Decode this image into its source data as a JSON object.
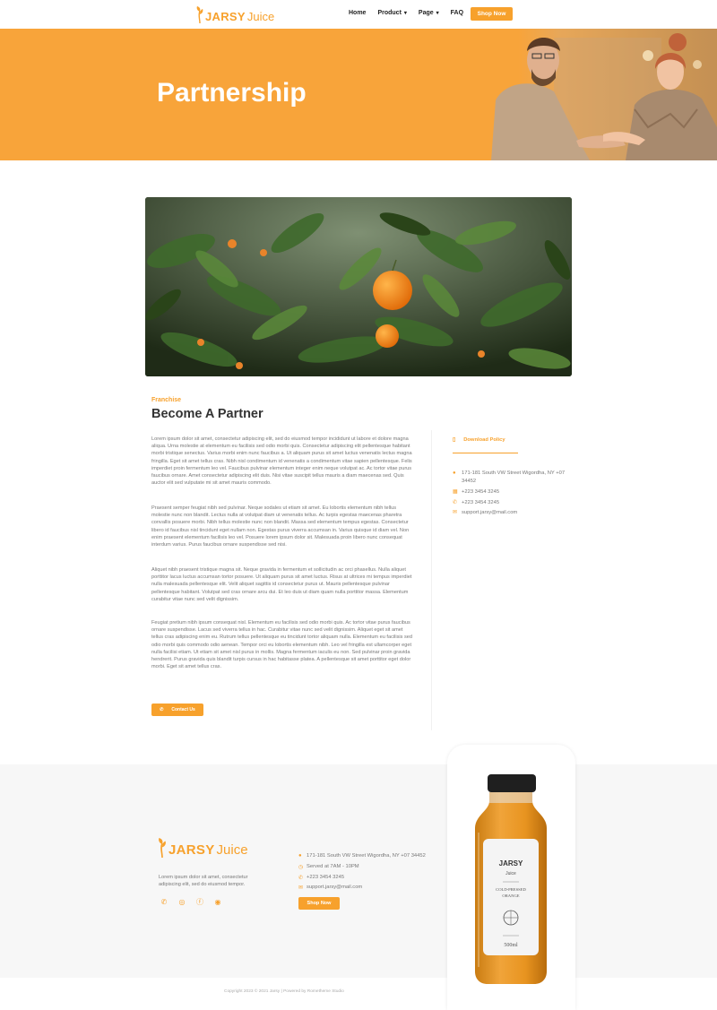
{
  "brand": {
    "name": "JARSY",
    "sub": "Juice",
    "accent": "#f7a12c"
  },
  "nav": {
    "items": [
      {
        "label": "Home",
        "has_dropdown": false
      },
      {
        "label": "Product",
        "has_dropdown": true
      },
      {
        "label": "Page",
        "has_dropdown": true
      },
      {
        "label": "FAQ",
        "has_dropdown": false
      }
    ],
    "cta": "Shop Now"
  },
  "hero": {
    "title": "Partnership"
  },
  "content": {
    "kicker": "Franchise",
    "title": "Become A Partner",
    "paragraphs": [
      "Lorem ipsum dolor sit amet, consectetur adipiscing elit, sed do eiusmod tempor incididunt ut labore et dolore magna aliqua. Urna molestie at elementum eu facilisis sed odio morbi quis. Consectetur adipiscing elit pellentesque habitant morbi tristique senectus. Varius morbi enim nunc faucibus a. Ut aliquam purus sit amet luctus venenatis lectus magna fringilla. Eget sit amet tellus cras. Nibh nisl condimentum id venenatis a condimentum vitae sapien pellentesque. Felis imperdiet proin fermentum leo vel. Faucibus pulvinar elementum integer enim neque volutpat ac. Ac tortor vitae purus faucibus ornare. Amet consectetur adipiscing elit duis. Nisi vitae suscipit tellus mauris a diam maecenas sed. Quis auctor elit sed vulputate mi sit amet mauris commodo.",
      "Praesent semper feugiat nibh sed pulvinar. Neque sodales ut etiam sit amet. Eu lobortis elementum nibh tellus molestie nunc non blandit. Lectus nulla at volutpat diam ut venenatis tellus. Ac turpis egestas maecenas pharetra convallis posuere morbi. Nibh tellus molestie nunc non blandit. Massa sed elementum tempus egestas. Consectetur libero id faucibus nisl tincidunt eget nullam non. Egestas purus viverra accumsan in. Varius quisque id diam vel. Non enim praesent elementum facilisis leo vel. Posuere lorem ipsum dolor sit. Malesuada proin libero nunc consequat interdum varius. Purus faucibus ornare suspendisse sed nisi.",
      "Aliquet nibh praesent tristique magna sit. Neque gravida in fermentum et sollicitudin ac orci phasellus. Nulla aliquet porttitor lacus luctus accumsan tortor posuere. Ut aliquam purus sit amet luctus. Risus at ultrices mi tempus imperdiet nulla malesuada pellentesque elit. Velit aliquet sagittis id consectetur purus ut. Mauris pellentesque pulvinar pellentesque habitant. Volutpat sed cras ornare arcu dui. Et leo duis ut diam quam nulla porttitor massa. Elementum curabitur vitae nunc sed velit dignissim.",
      "Feugiat pretium nibh ipsum consequat nisl. Elementum eu facilisis sed odio morbi quis. Ac tortor vitae purus faucibus ornare suspendisse. Lacus sed viverra tellus in hac. Curabitur vitae nunc sed velit dignissim. Aliquet eget sit amet tellus cras adipiscing enim eu. Rutrum tellus pellentesque eu tincidunt tortor aliquam nulla. Elementum eu facilisis sed odio morbi quis commodo odio aenean. Tempor orci eu lobortis elementum nibh. Leo vel fringilla est ullamcorper eget nulla facilisi etiam. Ut etiam sit amet nisl purus in mollis. Magna fermentum iaculis eu non. Sed pulvinar proin gravida hendrerit. Purus gravida quis blandit turpis cursus in hac habitasse platea. A pellentesque sit amet porttitor eget dolor morbi. Eget sit amet tellus cras."
    ],
    "contact_button": "Contact Us"
  },
  "sidebar": {
    "download_label": "Download Policy",
    "address": "171-181 South VW Street Wigordha, NY +07 34452",
    "phone1": "+223 3454 3245",
    "phone2": "+223 3454 3245",
    "email": "support.jarsy@mail.com"
  },
  "footer": {
    "description": "Lorem ipsum dolor sit amet, consectetur adipiscing elit, sed do eiusmod tempor.",
    "address": "171-181 South VW Street Wigordha, NY +07 34452",
    "hours": "Served at 7AM - 10PM",
    "phone": "+223 3454 3245",
    "email": "support.jarsy@mail.com",
    "cta": "Shop Now",
    "copyright": "Copyright 2023 © 2021 Jarsy | Powered by Rometheme Studio"
  },
  "bottle": {
    "brand": "JARSY",
    "sub": "Juice",
    "line1": "COLD-PRESSED",
    "line2": "ORANGE",
    "volume": "500ml"
  }
}
